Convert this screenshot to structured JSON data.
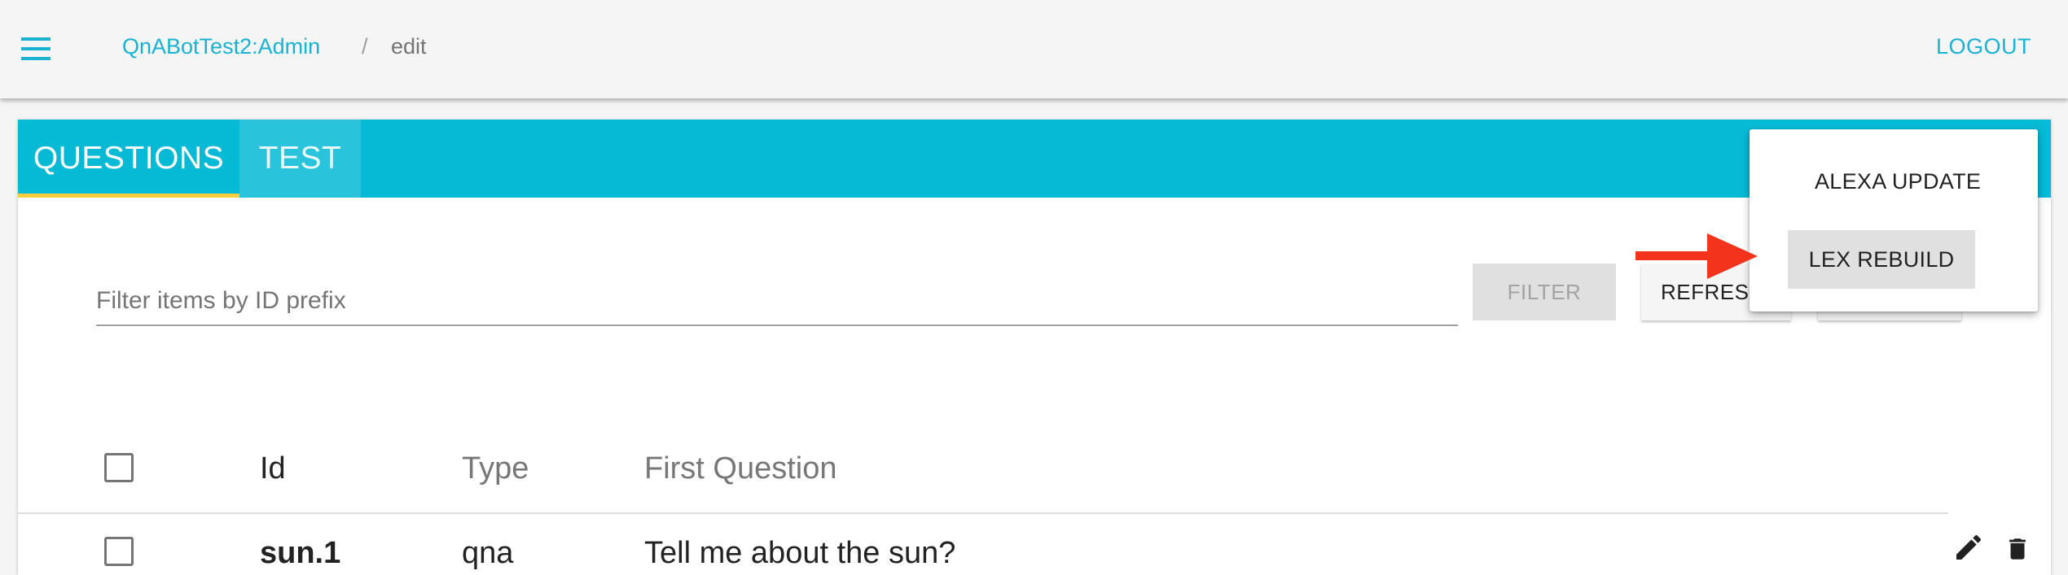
{
  "header": {
    "app_link": "QnABotTest2:Admin",
    "separator": "/",
    "current_page": "edit",
    "logout_label": "LOGOUT"
  },
  "tabs": [
    {
      "label": "QUESTIONS",
      "active": true
    },
    {
      "label": "TEST",
      "active": false
    }
  ],
  "toolbar": {
    "filter_placeholder": "Filter items by ID prefix",
    "filter_label": "FILTER",
    "refresh_label": "REFRES"
  },
  "table": {
    "columns": [
      "Id",
      "Type",
      "First Question"
    ],
    "rows": [
      {
        "id": "sun.1",
        "type": "qna",
        "first_question": "Tell me about the sun?"
      }
    ]
  },
  "menu": {
    "items": [
      "ALEXA UPDATE",
      "LEX REBUILD"
    ],
    "highlighted": "LEX REBUILD"
  },
  "colors": {
    "accent": "#06bad6",
    "link": "#1ab2d2",
    "tab_indicator": "#ffce3a",
    "annotation_arrow": "#f3331c"
  },
  "icons": [
    "hamburger-menu-icon",
    "edit-pencil-icon",
    "trash-icon",
    "red-arrow-icon"
  ]
}
